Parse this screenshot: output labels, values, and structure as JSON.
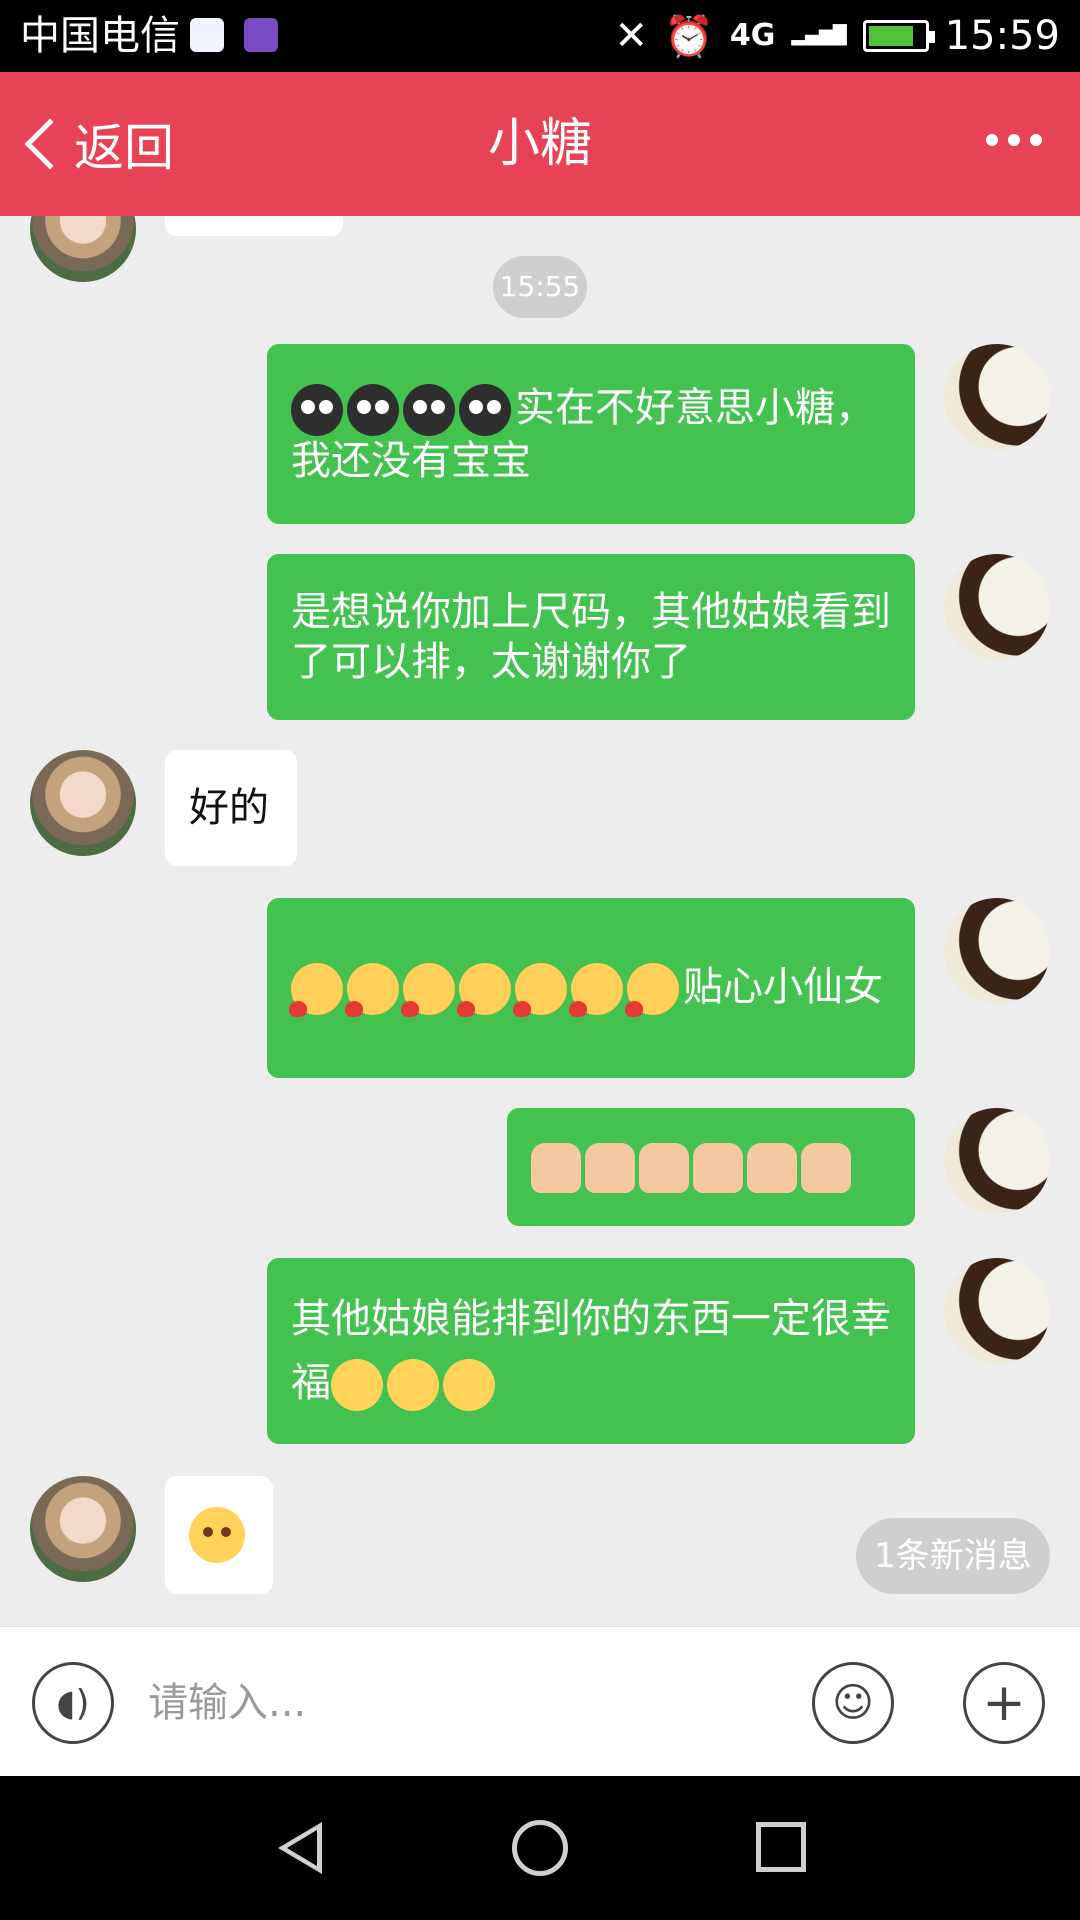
{
  "status_bar": {
    "carrier": "中国电信",
    "network": "4G",
    "time": "15:59",
    "icons": [
      "cloud-app-icon",
      "gallery-app-icon",
      "mute-icon",
      "alarm-icon",
      "signal-icon",
      "battery-icon"
    ]
  },
  "header": {
    "back_label": "返回",
    "title": "小糖",
    "bg_color": "#e84257"
  },
  "chat": {
    "timestamp": "15:55",
    "messages": [
      {
        "from": "me",
        "emoji": "cry",
        "emoji_count": 4,
        "text": "实在不好意思小糖，我还没有宝宝"
      },
      {
        "from": "me",
        "text": "是想说你加上尺码，其他姑娘看到了可以排，太谢谢你了"
      },
      {
        "from": "her",
        "text": "好的"
      },
      {
        "from": "me",
        "emoji": "blush-heart",
        "emoji_count": 7,
        "text": "贴心小仙女"
      },
      {
        "from": "me",
        "emoji": "thumbs-up",
        "emoji_count": 6,
        "text": ""
      },
      {
        "from": "me",
        "text": "其他姑娘能排到你的东西一定很幸福",
        "emoji_after": "wink",
        "emoji_after_count": 3
      },
      {
        "from": "her",
        "emoji": "shy",
        "emoji_count": 1,
        "text": ""
      }
    ],
    "new_message_badge": "1条新消息",
    "my_bubble_color": "#43c24f"
  },
  "input_bar": {
    "placeholder": "请输入..."
  },
  "nav_bar": {
    "icons": [
      "back-icon",
      "home-icon",
      "recents-icon"
    ]
  }
}
